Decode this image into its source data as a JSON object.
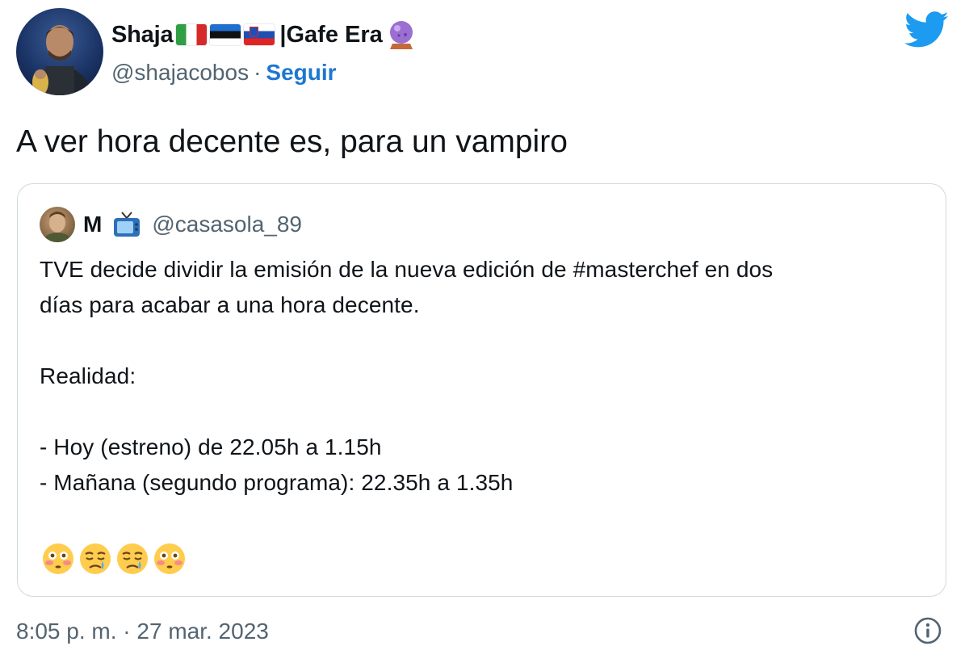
{
  "author": {
    "name": "Shaja",
    "name_suffix": "|Gafe Era",
    "flags": [
      "flag-italy",
      "flag-estonia",
      "flag-slovenia"
    ],
    "name_emoji": "crystal-ball-icon",
    "handle": "@shajacobos",
    "separator": "·",
    "follow_label": "Seguir"
  },
  "tweet": {
    "text": "A ver hora decente es, para un vampiro"
  },
  "quoted_tweet": {
    "name": "M",
    "name_emoji": "tv-icon",
    "handle": "@casasola_89",
    "lines": [
      "TVE decide dividir la emisión de la nueva edición de #masterchef en dos",
      "días para acabar a una hora decente.",
      "",
      "Realidad:",
      "",
      "- Hoy (estreno) de 22.05h a 1.15h",
      "- Mañana (segundo programa): 22.35h a  1.35h",
      ""
    ],
    "emojis": [
      "flushed-face-icon",
      "sad-relieved-face-icon",
      "sad-relieved-face-icon",
      "flushed-face-icon"
    ]
  },
  "footer": {
    "timestamp": "8:05 p. m. · 27 mar. 2023",
    "info_icon": "info-icon"
  },
  "colors": {
    "text": "#0f1419",
    "secondary": "#536471",
    "link": "#1d77d1",
    "twitter_blue": "#1d9bf0",
    "border": "#cfd9de"
  }
}
